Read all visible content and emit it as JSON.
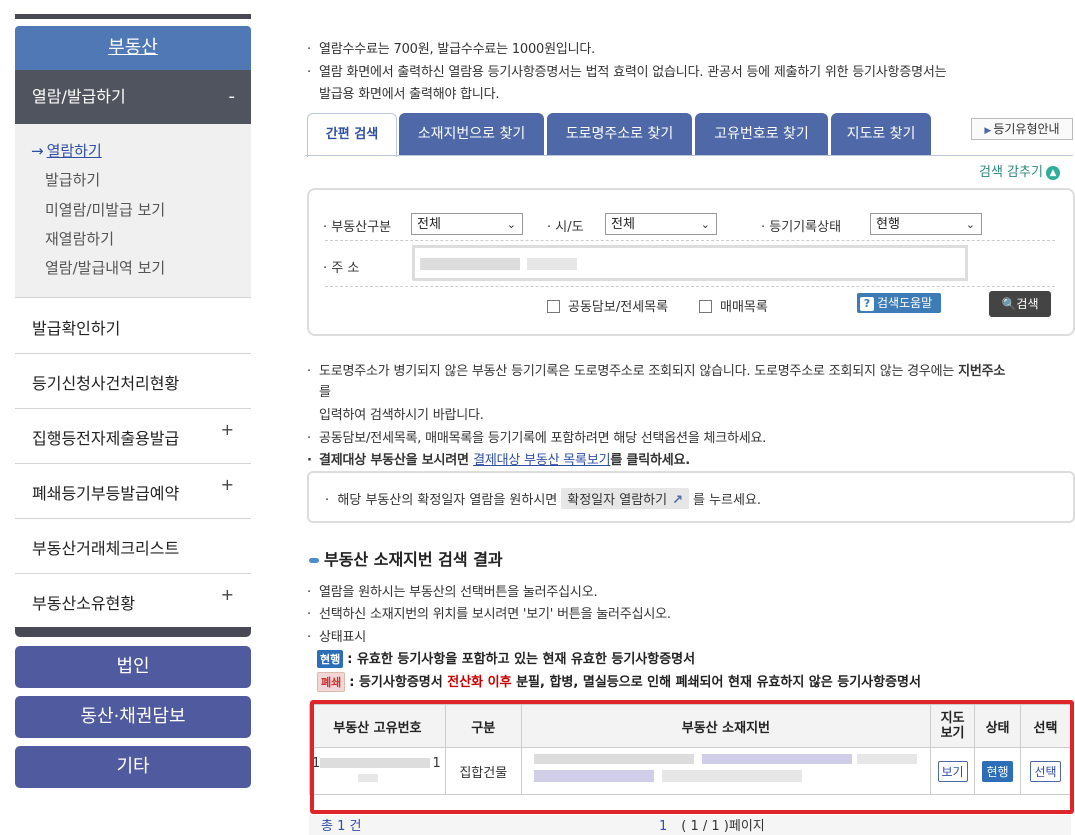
{
  "sidebar": {
    "title": "부동산",
    "active_menu": {
      "label": "열람/발급하기",
      "sign": "-"
    },
    "sub_items": [
      {
        "label": "열람하기",
        "arrow": "→"
      },
      {
        "label": "발급하기"
      },
      {
        "label": "미열람/미발급 보기"
      },
      {
        "label": "재열람하기"
      },
      {
        "label": "열람/발급내역 보기"
      }
    ],
    "menus": [
      {
        "label": "발급확인하기",
        "plus": ""
      },
      {
        "label": "등기신청사건처리현황",
        "plus": ""
      },
      {
        "label": "집행등전자제출용발급",
        "plus": "+"
      },
      {
        "label": "폐쇄등기부등발급예약",
        "plus": "+"
      },
      {
        "label": "부동산거래체크리스트",
        "plus": ""
      },
      {
        "label": "부동산소유현황",
        "plus": "+"
      }
    ],
    "big_buttons": [
      "법인",
      "동산·채권담보",
      "기타"
    ]
  },
  "notices": {
    "fee": "열람수수료는 700원, 발급수수료는 1000원입니다.",
    "print_line1": "열람 화면에서 출력하신 열람용 등기사항증명서는 법적 효력이 없습니다. 관공서 등에 제출하기 위한 등기사항증명서는",
    "print_line2": "발급용 화면에서 출력해야 합니다."
  },
  "tabs": [
    "간편 검색",
    "소재지번으로 찾기",
    "도로명주소로 찾기",
    "고유번호로 찾기",
    "지도로 찾기"
  ],
  "registry_type_button": "등기유형안내",
  "hide_search": "검색 감추기",
  "search": {
    "type_label": "부동산구분",
    "type_value": "전체",
    "sido_label": "시/도",
    "sido_value": "전체",
    "status_label": "등기기록상태",
    "status_value": "현행",
    "address_label": "주 소",
    "check1": "공동담보/전세목록",
    "check2": "매매목록",
    "help_button": "검색도움말",
    "search_button": "검색"
  },
  "info": {
    "road_line1": "도로명주소가 병기되지 않은 부동산 등기기록은 도로명주소로 조회되지 않습니다. 도로명주소로 조회되지 않는 경우에는",
    "road_bold": "지번주소",
    "road_line2": "를",
    "road_line3": "입력하여 검색하시기 바랍니다.",
    "check_line": "공동담보/전세목록, 매매목록을 등기기록에 포함하려면 해당 선택옵션을 체크하세요.",
    "pay_pre": "결제대상 부동산을 보시려면 ",
    "pay_link": "결제대상 부동산 목록보기",
    "pay_post": "를 클릭하세요."
  },
  "confirm_box": {
    "text_pre": "해당 부동산의 확정일자 열람을 원하시면",
    "button": "확정일자 열람하기",
    "text_post": "를 누르세요."
  },
  "results": {
    "title": "부동산 소재지번 검색 결과",
    "help1": "열람을 원하시는 부동산의 선택버튼을 눌러주십시오.",
    "help2": "선택하신 소재지번의 위치를 보시려면 '보기' 버튼을 눌러주십시오.",
    "status_label": "상태표시",
    "legend_current_badge": "현행",
    "legend_current_text": ": 유효한 등기사항을 포함하고 있는 현재 유효한 등기사항증명서",
    "legend_closed_badge": "폐쇄",
    "legend_closed_pre": ": 등기사항증명서 ",
    "legend_closed_red": "전산화 이후",
    "legend_closed_post": " 분필, 합병, 멸실등으로 인해 폐쇄되어 현재 유효하지 않은 등기사항증명서",
    "columns": [
      "부동산 고유번호",
      "구분",
      "부동산 소재지번",
      "지도보기",
      "상태",
      "선택"
    ],
    "rows": [
      {
        "id_start": "1",
        "id_end": "1",
        "type": "집합건물",
        "map": "보기",
        "status": "현행",
        "select": "선택"
      }
    ],
    "total": "총 1 건",
    "page_number": "1",
    "page_info": "( 1 / 1 )페이지"
  }
}
